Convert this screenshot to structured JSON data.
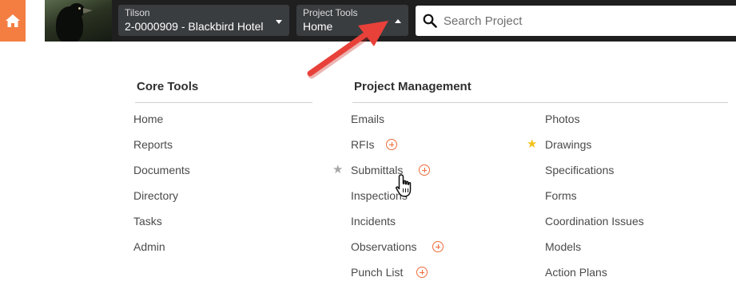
{
  "topbar": {
    "home_icon": "home-icon",
    "company_selector": {
      "label": "Tilson",
      "value": "2-0000909 - Blackbird Hotel"
    },
    "tools_selector": {
      "label": "Project Tools",
      "value": "Home"
    },
    "search": {
      "placeholder": "Search Project",
      "icon": "search-icon"
    }
  },
  "core_tools": {
    "title": "Core Tools",
    "items": [
      "Home",
      "Reports",
      "Documents",
      "Directory",
      "Tasks",
      "Admin"
    ]
  },
  "project_management": {
    "title": "Project Management",
    "col1": [
      "Emails",
      "RFIs",
      "Submittals",
      "Inspections",
      "Incidents",
      "Observations",
      "Punch List"
    ],
    "col2": [
      "Photos",
      "Drawings",
      "Specifications",
      "Forms",
      "Coordination Issues",
      "Models",
      "Action Plans"
    ]
  },
  "colors": {
    "topbar_bg": "#1f1f1f",
    "home_accent": "#f47e42",
    "add_icon": "#f06b3a",
    "favorite_star": "#f3c21b",
    "annotation_arrow": "#e8413a"
  }
}
